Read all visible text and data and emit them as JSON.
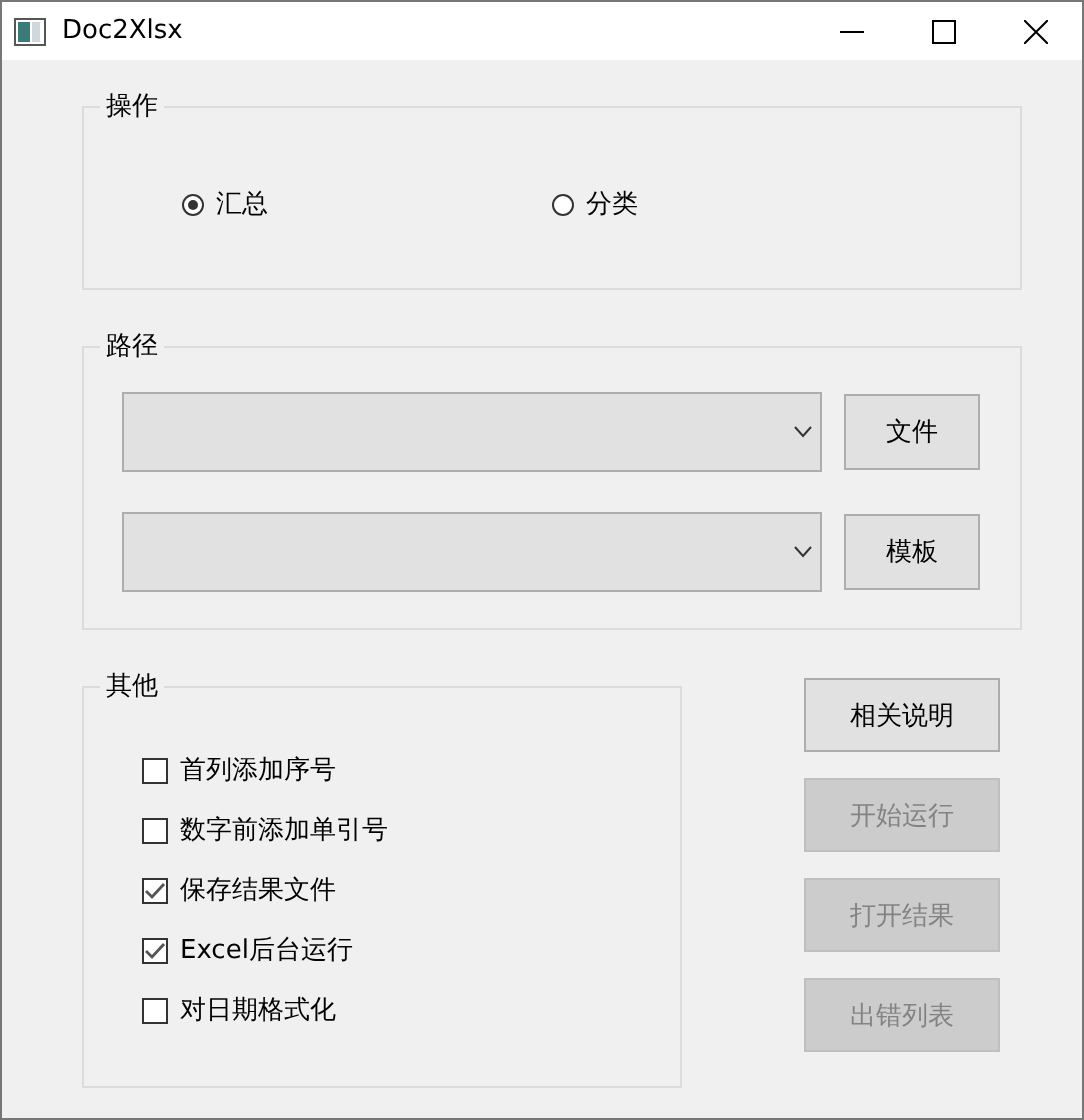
{
  "window": {
    "title": "Doc2Xlsx"
  },
  "operation": {
    "title": "操作",
    "options": [
      {
        "label": "汇总",
        "selected": true
      },
      {
        "label": "分类",
        "selected": false
      }
    ]
  },
  "path": {
    "title": "路径",
    "rows": [
      {
        "button": "文件"
      },
      {
        "button": "模板"
      }
    ]
  },
  "other": {
    "title": "其他",
    "options": [
      {
        "label": "首列添加序号",
        "checked": false
      },
      {
        "label": "数字前添加单引号",
        "checked": false
      },
      {
        "label": "保存结果文件",
        "checked": true
      },
      {
        "label": "Excel后台运行",
        "checked": true
      },
      {
        "label": "对日期格式化",
        "checked": false
      }
    ]
  },
  "buttons": [
    {
      "label": "相关说明",
      "disabled": false
    },
    {
      "label": "开始运行",
      "disabled": true
    },
    {
      "label": "打开结果",
      "disabled": true
    },
    {
      "label": "出错列表",
      "disabled": true
    }
  ]
}
